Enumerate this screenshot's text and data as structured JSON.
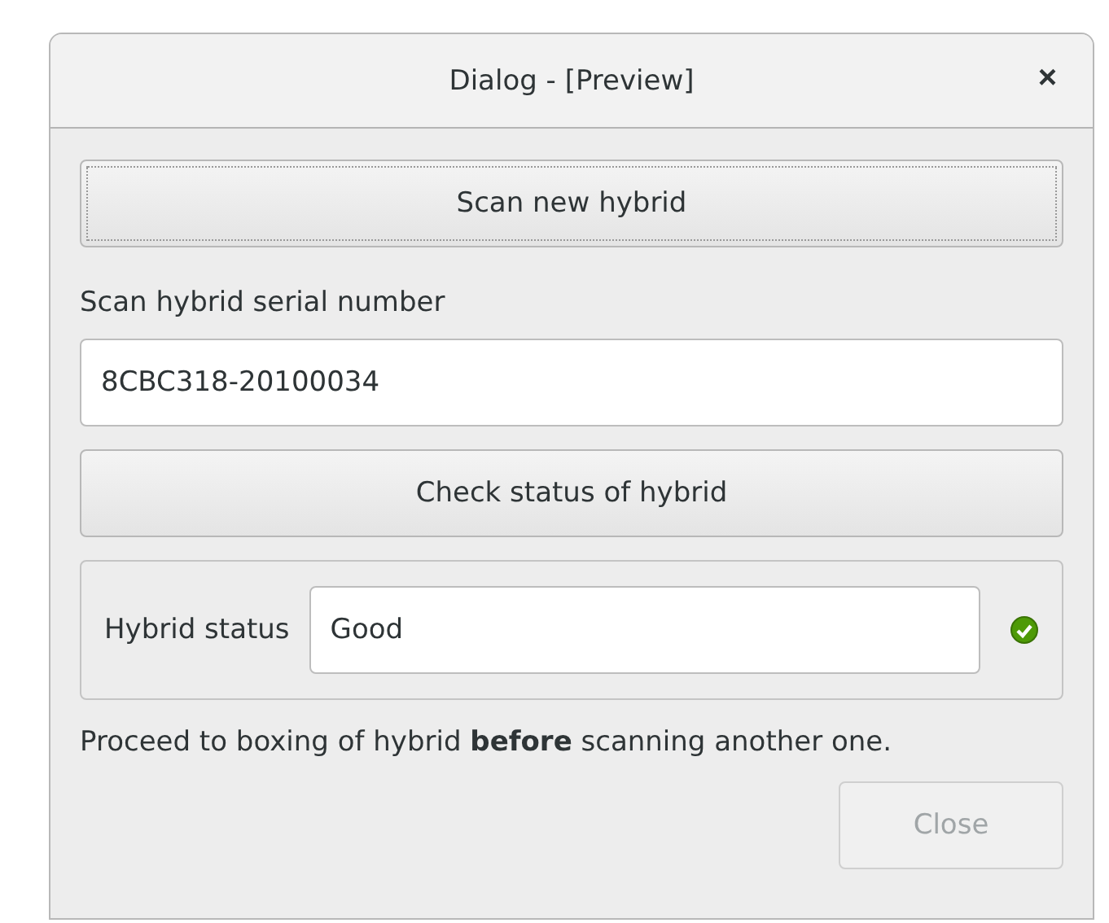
{
  "window": {
    "title": "Dialog - [Preview]",
    "close_symbol": "×"
  },
  "scan_button": {
    "label": "Scan new hybrid",
    "focused": true
  },
  "serial_label": "Scan hybrid serial number",
  "serial_field": {
    "value": "8CBC318-20100034"
  },
  "check_button": {
    "label": "Check status of hybrid"
  },
  "status": {
    "label": "Hybrid status",
    "value": "Good",
    "ok": true
  },
  "message": "Proceed to boxing of hybrid **before** scanning another one.",
  "close_button": {
    "label": "Close",
    "disabled": true
  }
}
